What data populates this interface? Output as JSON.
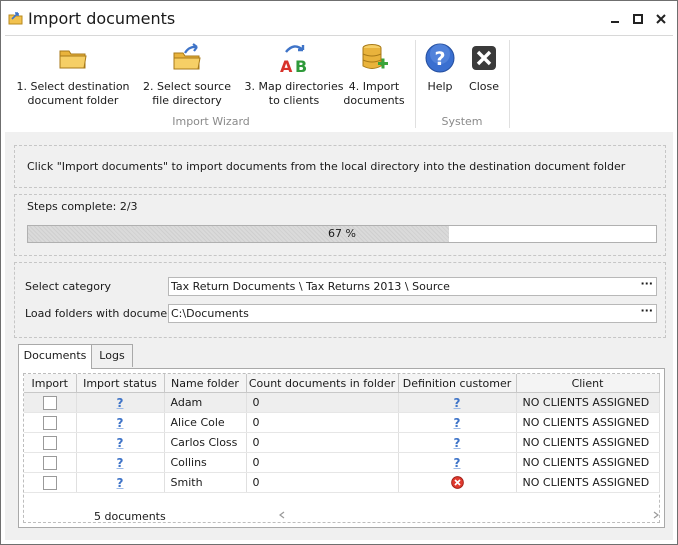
{
  "window": {
    "title": "Import documents"
  },
  "ribbon": {
    "wizard_group_label": "Import Wizard",
    "system_group_label": "System",
    "buttons": [
      {
        "line1": "1. Select destination",
        "line2": "document folder"
      },
      {
        "line1": "2. Select source",
        "line2": "file directory"
      },
      {
        "line1": "3. Map directories",
        "line2": "to clients"
      },
      {
        "line1": "4. Import",
        "line2": "documents"
      }
    ],
    "help_label": "Help",
    "close_label": "Close"
  },
  "info": {
    "text": "Click \"Import documents\" to import documents from the local directory into the destination document folder"
  },
  "steps": {
    "label": "Steps complete: 2/3",
    "progress_fraction": 0.67,
    "progress_text": "67 %"
  },
  "fields": {
    "category_label": "Select category",
    "category_value": "Tax Return Documents \\ Tax Returns 2013 \\ Source",
    "folders_label": "Load folders with documents",
    "folders_value": "C:\\Documents",
    "browse_glyph": "···"
  },
  "tabs": [
    {
      "label": "Documents",
      "active": true
    },
    {
      "label": "Logs",
      "active": false
    }
  ],
  "grid": {
    "columns": [
      "Import",
      "Import status",
      "Name folder",
      "Count documents in folder",
      "Definition customer",
      "Client"
    ],
    "rows": [
      {
        "name": "Adam",
        "count": "0",
        "status": "?",
        "definition": "?",
        "client": "NO CLIENTS ASSIGNED",
        "definition_icon": "question-icon"
      },
      {
        "name": "Alice Cole",
        "count": "0",
        "status": "?",
        "definition": "?",
        "client": "NO CLIENTS ASSIGNED",
        "definition_icon": "question-icon"
      },
      {
        "name": "Carlos Closs",
        "count": "0",
        "status": "?",
        "definition": "?",
        "client": "NO CLIENTS ASSIGNED",
        "definition_icon": "question-icon"
      },
      {
        "name": "Collins",
        "count": "0",
        "status": "?",
        "definition": "?",
        "client": "NO CLIENTS ASSIGNED",
        "definition_icon": "question-icon"
      },
      {
        "name": "Smith",
        "count": "0",
        "status": "?",
        "definition": "",
        "client": "NO CLIENTS ASSIGNED",
        "definition_icon": "error-icon"
      }
    ],
    "footer_count": "5 documents"
  },
  "colors": {
    "accent_blue": "#3f74c8",
    "error_red": "#e03a2f",
    "folder_yellow": "#f2c24f"
  }
}
